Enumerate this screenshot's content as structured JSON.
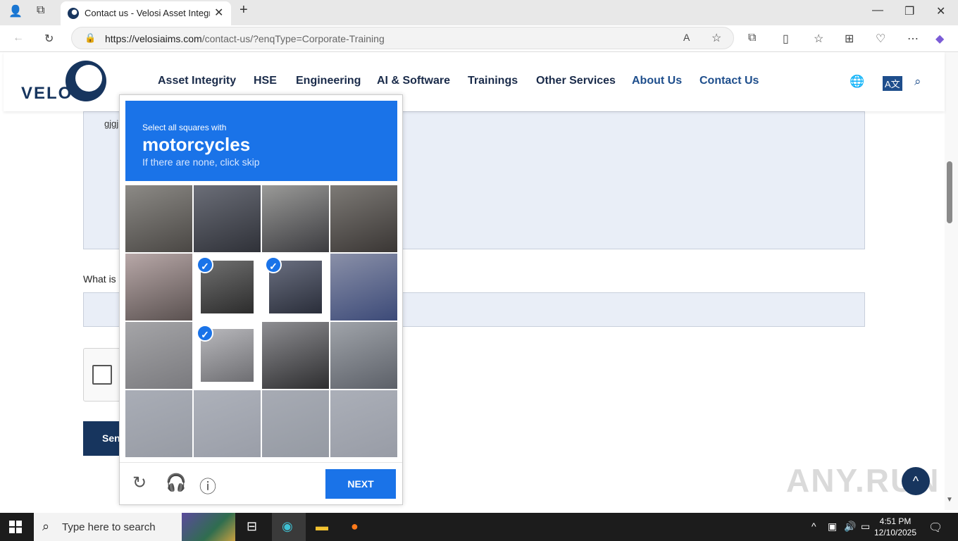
{
  "browser": {
    "tab_title": "Contact us - Velosi Asset Integrity",
    "url_domain": "https://velosiaims.com",
    "url_path": "/contact-us/?enqType=Corporate-Training"
  },
  "site": {
    "logo_text": "VELOSI",
    "nav": [
      "Asset Integrity",
      "HSE",
      "Engineering",
      "AI & Software",
      "Trainings",
      "Other Services",
      "About Us",
      "Contact Us"
    ]
  },
  "form": {
    "textarea_value": "gjgj",
    "question_label": "What is",
    "send_label": "Sen"
  },
  "captcha": {
    "prompt": "Select all squares with",
    "target": "motorcycles",
    "hint": "If there are none, click skip",
    "next_label": "NEXT",
    "selected_tiles": [
      5,
      6,
      9
    ]
  },
  "watermark": "ANY.RUN",
  "taskbar": {
    "search_placeholder": "Type here to search",
    "time": "4:51 PM",
    "date": "12/10/2025"
  }
}
